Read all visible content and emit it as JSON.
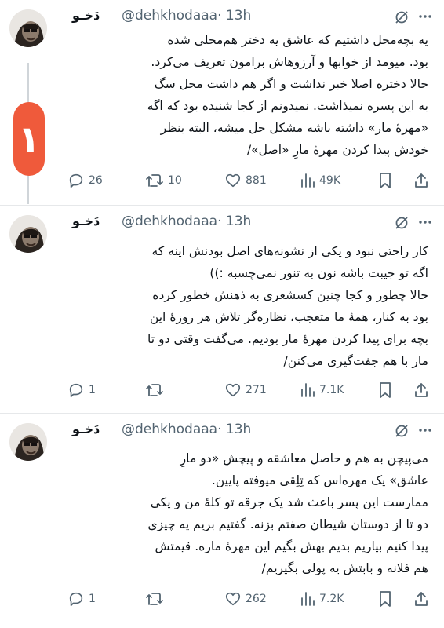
{
  "colors": {
    "accent_badge": "#ef5a3b",
    "muted": "#536471",
    "text": "#0f1419",
    "thread_line": "#d0d5d9"
  },
  "icons": [
    "grok-icon",
    "more-icon",
    "reply-icon",
    "retweet-icon",
    "like-icon",
    "views-icon",
    "bookmark-icon",
    "share-icon"
  ],
  "thread_badge": "۱",
  "tweets": [
    {
      "name": "دَخـو",
      "handle": "@dehkhodaaa",
      "time": "· 13h",
      "lines": [
        "یه بچه‌محل داشتیم که عاشق یه دختر هم‌محلی شده",
        "بود. میومد از خوابها و آرزوهاش برامون تعریف می‌کرد.",
        "حالا دختره اصلا خبر نداشت و اگر هم داشت محل سگ",
        "به این پسره نمیذاشت. نمیدونم از کجا شنیده بود که اگه",
        "«مهرهٔ مار» داشته باشه مشکل حل میشه، البته بنظر",
        "خودش پیدا کردن مهرهٔ مارِ «اصل»/"
      ],
      "replies": "26",
      "retweets": "10",
      "likes": "881",
      "views": "49K"
    },
    {
      "name": "دَخـو",
      "handle": "@dehkhodaaa",
      "time": "· 13h",
      "lines": [
        "کار راحتی نبود و یکی از نشونه‌های اصل بودنش اینه که",
        "اگه تو جیبت باشه نون به تنور نمی‌چسبه :))",
        "حالا چطور و کجا چنین کسشعری به ذهنش خطور کرده",
        "بود به کنار، همهٔ ما متعجب، نظاره‌گر تلاش هر روزهٔ این",
        "بچه برای پیدا کردن مهرهٔ مار بودیم. می‌گفت وقتی دو تا",
        "مار با هم جفت‌گیری می‌کنن/"
      ],
      "replies": "1",
      "retweets": "",
      "likes": "271",
      "views": "7.1K"
    },
    {
      "name": "دَخـو",
      "handle": "@dehkhodaaa",
      "time": "· 13h",
      "lines": [
        "می‌پیچن به هم و حاصل معاشقه و پیچش «دو مارِ",
        "عاشق» یک مهره‌اس که تِلِقی میوفته پایین.",
        "ممارست این پسر باعث شد یک جرقه تو کلهٔ من و یکی",
        "دو تا از دوستان شیطان صفتم بزنه. گفتیم بریم یه چیزی",
        "پیدا کنیم بیاریم بدیم بهش بگیم این مهرهٔ ماره. قیمتش",
        "هم فلانه و بابتش یه پولی بگیریم/"
      ],
      "replies": "1",
      "retweets": "",
      "likes": "262",
      "views": "7.2K"
    }
  ]
}
